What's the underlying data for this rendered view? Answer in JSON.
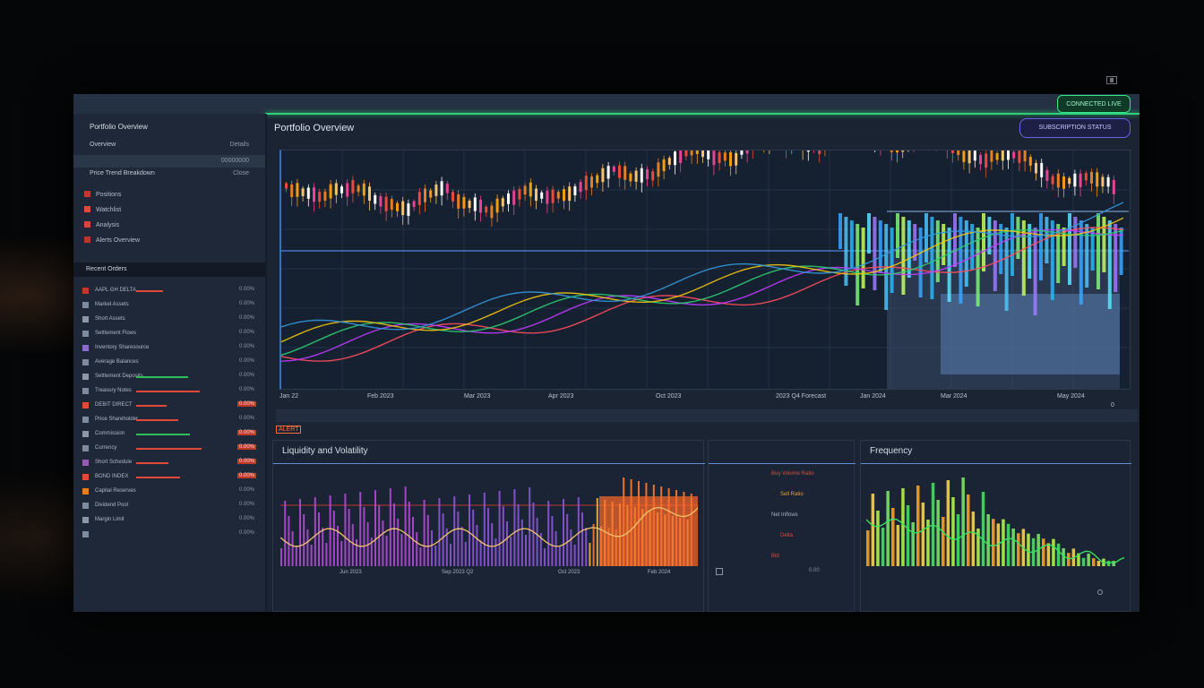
{
  "header": {
    "green_button": "CONNECTED LIVE",
    "purple_button": "SUBSCRIPTION STATUS"
  },
  "sidebar": {
    "title": "Portfolio Overview",
    "rows": [
      {
        "label": "Overview",
        "value": "Details"
      },
      {
        "label": "",
        "value": "00000000"
      },
      {
        "label": "Price Trend Breakdown",
        "value": "Close"
      }
    ],
    "menu": [
      "Positions",
      "Watchlist",
      "Analysis",
      "Alerts Overview"
    ],
    "section": "Recent Orders",
    "list": [
      {
        "label": "AAPL  GH DELTA",
        "value": "0.00%",
        "bar": "#e04a3a",
        "neg": false
      },
      {
        "label": "Market Assets",
        "value": "0.00%",
        "bar": "",
        "neg": false
      },
      {
        "label": "Short Assets",
        "value": "0.00%",
        "bar": "",
        "neg": false
      },
      {
        "label": "Settlement Flows",
        "value": "0.00%",
        "bar": "",
        "neg": false
      },
      {
        "label": "Inventory Sharesource",
        "value": "0.00%",
        "bar": "",
        "neg": false
      },
      {
        "label": "Average Balances",
        "value": "0.00%",
        "bar": "",
        "neg": false
      },
      {
        "label": "Settlement Deposits",
        "value": "0.00%",
        "bar": "#2fbf5a",
        "neg": false
      },
      {
        "label": "Treasury Notes",
        "value": "0.00%",
        "bar": "#e04a3a",
        "neg": false
      },
      {
        "label": "DEBIT DIRECT",
        "value": "0.00%",
        "bar": "#e04a3a",
        "neg": true
      },
      {
        "label": "Price Shareholder",
        "value": "0.00%",
        "bar": "#e04a3a",
        "neg": false
      },
      {
        "label": "Commission",
        "value": "0.00%",
        "bar": "#2fbf5a",
        "neg": true
      },
      {
        "label": "Currency",
        "value": "0.00%",
        "bar": "#e04a3a",
        "neg": true
      },
      {
        "label": "Short Schedule",
        "value": "0.00%",
        "bar": "#e04a3a",
        "neg": true
      },
      {
        "label": "BOND INDEX",
        "value": "0.00%",
        "bar": "#e04a3a",
        "neg": true
      },
      {
        "label": "Capital Reserves",
        "value": "0.00%",
        "bar": "",
        "neg": false
      },
      {
        "label": "Dividend Pool",
        "value": "0.00%",
        "bar": "",
        "neg": false
      },
      {
        "label": "Margin Limit",
        "value": "0.00%",
        "bar": "",
        "neg": false
      },
      {
        "label": "",
        "value": "0.00%",
        "bar": "",
        "neg": false
      }
    ]
  },
  "main": {
    "title": "Portfolio Overview",
    "x_ticks": [
      "Jan 22",
      "Feb 2023",
      "Mar 2023",
      "Apr 2023",
      "Oct 2023",
      "2023 Q4 Forecast",
      "Jan 2024",
      "Mar 2024",
      "May 2024"
    ],
    "x_end": "0"
  },
  "bottom": {
    "tag": "ALERT",
    "panel1": {
      "title": "Liquidity and Volatility",
      "ticks": [
        "Jun 2023",
        "Sep 2023 Q2",
        "Oct 2023",
        "Feb 2024"
      ]
    },
    "panel2": {
      "rows": [
        "Buy Volume Ratio",
        "Sell Ratio",
        "Net Inflows",
        "Delta",
        "Bid"
      ]
    },
    "panel3": {
      "title": "Frequency"
    }
  },
  "colors": {
    "accent_green": "#2fd27a",
    "accent_purple": "#6a63e8",
    "negative": "#e04a3a",
    "positive": "#2fbf5a"
  }
}
